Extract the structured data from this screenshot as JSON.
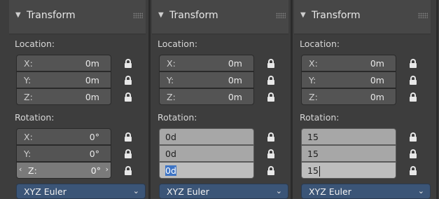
{
  "panels": [
    {
      "title": "Transform",
      "location_label": "Location:",
      "location": [
        {
          "key": "X:",
          "value": "0m"
        },
        {
          "key": "Y:",
          "value": "0m"
        },
        {
          "key": "Z:",
          "value": "0m"
        }
      ],
      "rotation_label": "Rotation:",
      "rotation": [
        {
          "key": "X:",
          "value": "0°"
        },
        {
          "key": "Y:",
          "value": "0°"
        },
        {
          "key": "Z:",
          "value": "0°"
        }
      ],
      "rotation_mode": "XYZ Euler"
    },
    {
      "title": "Transform",
      "location_label": "Location:",
      "location": [
        {
          "key": "X:",
          "value": "0m"
        },
        {
          "key": "Y:",
          "value": "0m"
        },
        {
          "key": "Z:",
          "value": "0m"
        }
      ],
      "rotation_label": "Rotation:",
      "rotation_text": [
        "0d",
        "0d",
        "0d"
      ],
      "rotation_mode": "XYZ Euler"
    },
    {
      "title": "Transform",
      "location_label": "Location:",
      "location": [
        {
          "key": "X:",
          "value": "0m"
        },
        {
          "key": "Y:",
          "value": "0m"
        },
        {
          "key": "Z:",
          "value": "0m"
        }
      ],
      "rotation_label": "Rotation:",
      "rotation_text": [
        "15",
        "15",
        "15"
      ],
      "rotation_mode": "XYZ Euler"
    }
  ]
}
